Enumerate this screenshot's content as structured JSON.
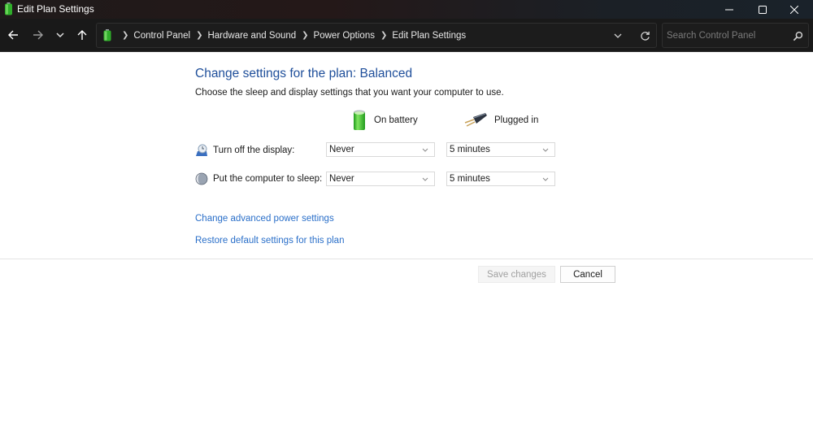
{
  "window": {
    "title": "Edit Plan Settings",
    "controls": {
      "minimize": "minimize",
      "maximize": "maximize",
      "close": "close"
    }
  },
  "nav": {
    "back_icon": "arrow-left-icon",
    "forward_icon": "arrow-right-icon",
    "recent_icon": "chevron-down-icon",
    "up_icon": "arrow-up-icon",
    "breadcrumbs": [
      "Control Panel",
      "Hardware and Sound",
      "Power Options",
      "Edit Plan Settings"
    ],
    "search_placeholder": "Search Control Panel",
    "search_value": ""
  },
  "main": {
    "heading": "Change settings for the plan: Balanced",
    "subtext": "Choose the sleep and display settings that you want your computer to use.",
    "columns": {
      "battery": "On battery",
      "plugged": "Plugged in"
    },
    "settings": [
      {
        "label": "Turn off the display:",
        "on_battery": "Never",
        "plugged_in": "5 minutes"
      },
      {
        "label": "Put the computer to sleep:",
        "on_battery": "Never",
        "plugged_in": "5 minutes"
      }
    ],
    "links": {
      "advanced": "Change advanced power settings",
      "restore": "Restore default settings for this plan"
    },
    "buttons": {
      "save": "Save changes",
      "cancel": "Cancel"
    }
  },
  "colors": {
    "heading": "#1e4e9a",
    "link": "#2a6fc9",
    "navbar_bg": "#191919",
    "battery_green": "#3fbf2a"
  }
}
